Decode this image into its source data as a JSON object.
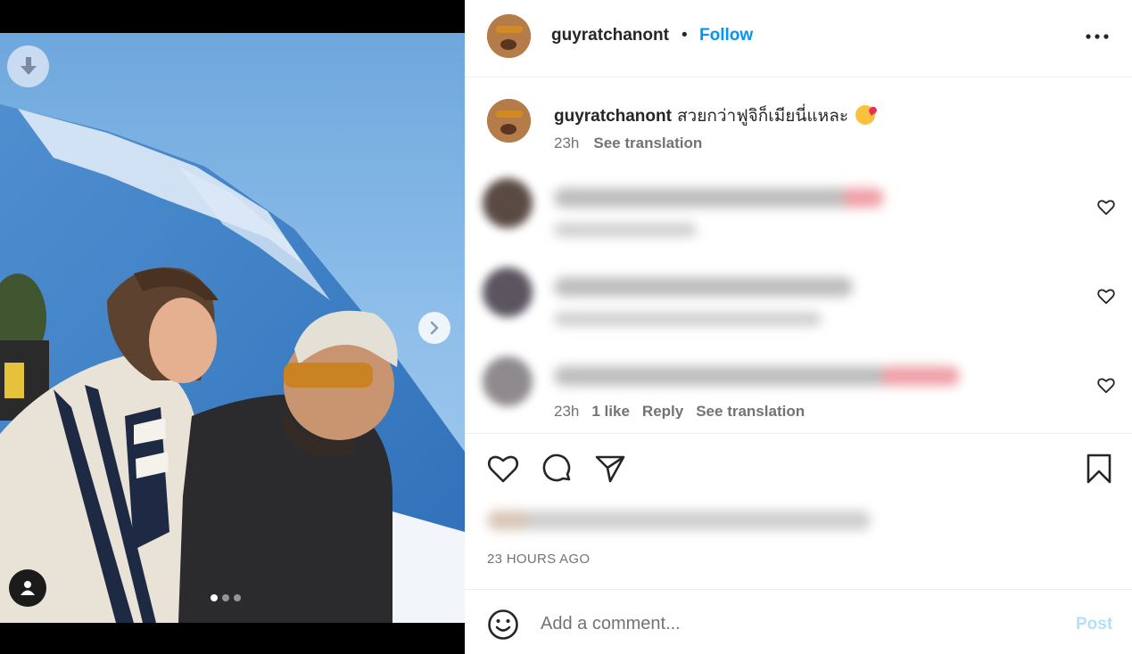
{
  "post": {
    "username": "guyratchanont",
    "separator": "•",
    "follow_label": "Follow",
    "more_icon": "more-horizontal-icon"
  },
  "caption": {
    "username": "guyratchanont",
    "text": "สวยกว่าฟูจิก็เมียนี่แหละ",
    "emoji": "face-blowing-kiss",
    "time": "23h",
    "see_translation": "See translation"
  },
  "comments": {
    "visible_meta": {
      "time": "23h",
      "likes": "1 like",
      "reply": "Reply",
      "see_translation": "See translation"
    }
  },
  "actions": {
    "like_icon": "heart-icon",
    "comment_icon": "comment-icon",
    "share_icon": "send-icon",
    "save_icon": "bookmark-icon"
  },
  "timestamp": "23 HOURS AGO",
  "composer": {
    "placeholder": "Add a comment...",
    "post_label": "Post"
  },
  "media": {
    "slide_count": 3,
    "active_slide": 1
  },
  "colors": {
    "accent": "#0095f6",
    "post_disabled": "#b2dffc",
    "muted_text": "#737373"
  }
}
